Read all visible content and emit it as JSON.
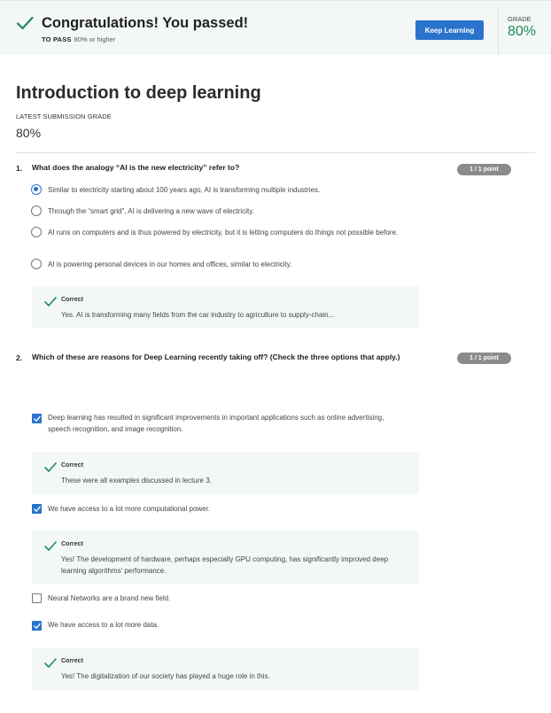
{
  "banner": {
    "title": "Congratulations! You passed!",
    "to_pass_label": "TO PASS",
    "to_pass_value": "80% or higher",
    "keep_learning": "Keep Learning",
    "grade_label": "GRADE",
    "grade_value": "80%"
  },
  "assignment": {
    "title": "Introduction to deep learning",
    "latest_label": "LATEST SUBMISSION GRADE",
    "latest_value": "80%"
  },
  "questions": [
    {
      "number": "1.",
      "text": "What does the analogy “AI is the new electricity” refer to?",
      "points": "1 / 1 point",
      "options": [
        "Similar to electricity starting about 100 years ago, AI is transforming multiple industries.",
        "Through the “smart grid”, AI is delivering a new wave of electricity.",
        "AI runs on computers and is thus powered by electricity, but it is letting computers do things not possible before.",
        "AI is powering personal devices in our homes and offices, similar to electricity."
      ],
      "feedback": {
        "label": "Correct",
        "text": "Yes. AI is transforming many fields from the car industry to agriculture to supply-chain..."
      }
    },
    {
      "number": "2.",
      "text": "Which of these are reasons for Deep Learning recently taking off? (Check the three options that apply.)",
      "points": "1 / 1 point",
      "options": [
        "Deep learning has resulted in significant improvements in important applications such as online advertising, speech recognition, and image recognition.",
        "We have access to a lot more computational power.",
        "Neural Networks are a brand new field.",
        "We have access to a lot more data."
      ],
      "feedback": [
        {
          "label": "Correct",
          "text": "These were all examples discussed in lecture 3."
        },
        {
          "label": "Correct",
          "text": "Yes! The development of hardware, perhaps especially GPU computing, has significantly improved deep learning algorithms' performance."
        },
        {
          "label": "Correct",
          "text": "Yes! The digitalization of our society has played a huge role in this."
        }
      ]
    }
  ],
  "colors": {
    "accent": "#2a73cc",
    "success": "#1e8a5a",
    "feedback_bg": "#f3f8f6"
  }
}
